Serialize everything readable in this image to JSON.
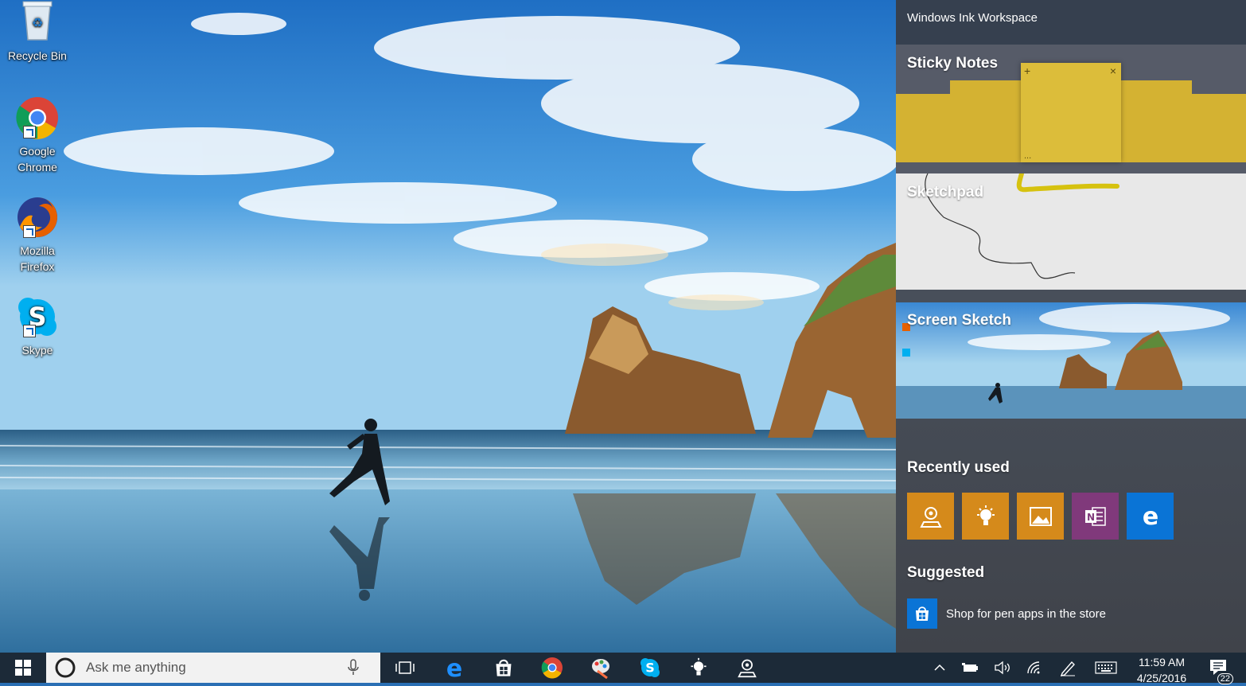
{
  "desktop": {
    "icons": [
      {
        "label": "Recycle Bin",
        "icon": "recycle-bin-icon"
      },
      {
        "label": "Google\nChrome",
        "icon": "chrome-icon"
      },
      {
        "label": "Mozilla\nFirefox",
        "icon": "firefox-icon"
      },
      {
        "label": "Skype",
        "icon": "skype-icon"
      }
    ]
  },
  "ink_workspace": {
    "title": "Windows Ink Workspace",
    "sticky_notes": {
      "label": "Sticky Notes",
      "add_glyph": "+",
      "close_glyph": "×",
      "more_glyph": "..."
    },
    "sketchpad": {
      "label": "Sketchpad"
    },
    "screen_sketch": {
      "label": "Screen Sketch"
    },
    "recently_used": {
      "label": "Recently used",
      "tiles": [
        {
          "icon": "maps-icon",
          "color": "#d58a1b"
        },
        {
          "icon": "tips-icon",
          "color": "#d58a1b"
        },
        {
          "icon": "photos-icon",
          "color": "#d58a1b"
        },
        {
          "icon": "onenote-icon",
          "color": "#80397b"
        },
        {
          "icon": "edge-icon",
          "color": "#0a74d6"
        }
      ]
    },
    "suggested": {
      "label": "Suggested",
      "item": "Shop for pen apps in the store",
      "icon": "store-icon"
    }
  },
  "taskbar": {
    "search_placeholder": "Ask me anything",
    "apps": [
      "task-view-icon",
      "edge-icon",
      "store-icon",
      "chrome-icon",
      "paint-icon",
      "skype-icon",
      "tips-icon",
      "maps-icon"
    ],
    "tray": [
      "chevron-up-icon",
      "battery-icon",
      "volume-icon",
      "wifi-icon",
      "pen-icon",
      "keyboard-icon"
    ],
    "time": "11:59 AM",
    "date": "4/25/2016",
    "notification_count": "22"
  }
}
